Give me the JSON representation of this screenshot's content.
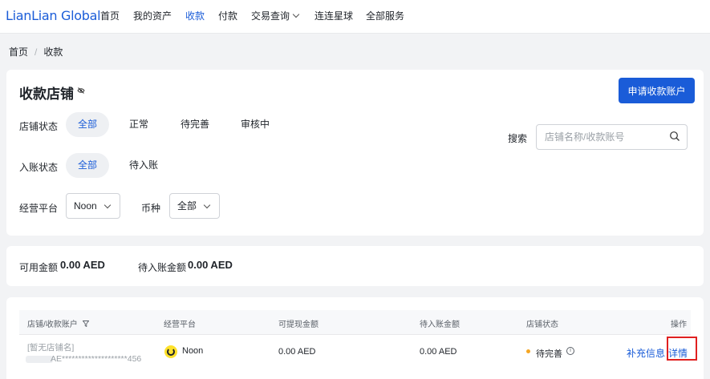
{
  "brand": {
    "logo": "LianLian Global"
  },
  "nav": {
    "items": [
      {
        "label": "首页"
      },
      {
        "label": "我的资产"
      },
      {
        "label": "收款"
      },
      {
        "label": "付款"
      },
      {
        "label": "交易查询"
      },
      {
        "label": "连连星球"
      },
      {
        "label": "全部服务"
      }
    ],
    "active_index": 2
  },
  "breadcrumb": {
    "home": "首页",
    "sep": "/",
    "current": "收款"
  },
  "page": {
    "title": "收款店铺",
    "apply_button": "申请收款账户"
  },
  "filters": {
    "shop_status": {
      "label": "店铺状态",
      "options": [
        "全部",
        "正常",
        "待完善",
        "审核中"
      ],
      "selected": "全部"
    },
    "entry_status": {
      "label": "入账状态",
      "options": [
        "全部",
        "待入账"
      ],
      "selected": "全部"
    },
    "platform": {
      "label": "经营平台",
      "value": "Noon"
    },
    "currency": {
      "label": "币种",
      "value": "全部"
    },
    "search": {
      "label": "搜索",
      "placeholder": "店铺名称/收款账号"
    }
  },
  "balance": {
    "available_label": "可用金额",
    "available_value": "0.00 AED",
    "pending_label": "待入账金额",
    "pending_value": "0.00 AED"
  },
  "table": {
    "columns": [
      "店铺/收款账户",
      "经营平台",
      "可提现金额",
      "待入账金额",
      "店铺状态",
      "操作"
    ],
    "rows": [
      {
        "shop_name": "[暂无店铺名]",
        "account": "AE********************456",
        "platform": "Noon",
        "withdrawable": "0.00 AED",
        "pending": "0.00 AED",
        "status": "待完善",
        "actions": [
          "补充信息",
          "详情"
        ]
      }
    ]
  },
  "colors": {
    "accent": "#1a5cd8",
    "status_pending": "#f5a623",
    "highlight": "#e02020"
  }
}
